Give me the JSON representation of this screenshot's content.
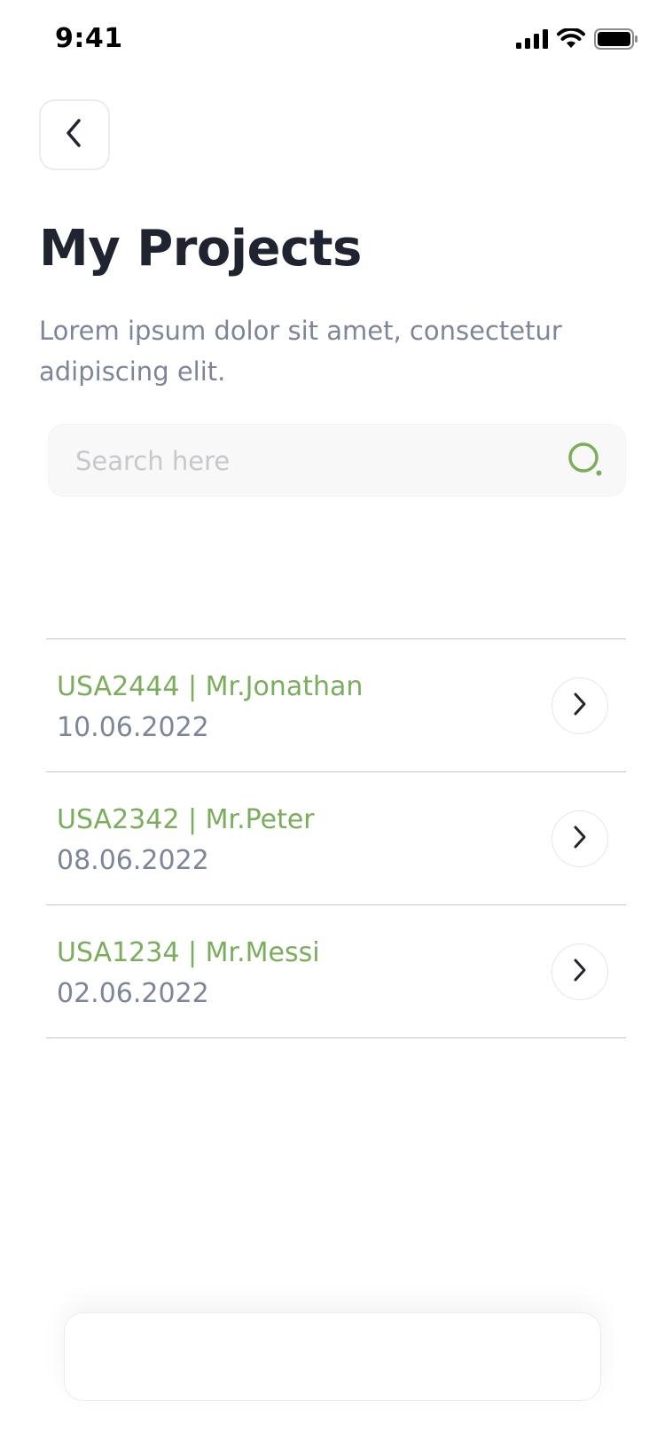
{
  "status_bar": {
    "time": "9:41",
    "icons": [
      "signal-icon",
      "wifi-icon",
      "battery-icon"
    ]
  },
  "header": {
    "back_icon": "chevron-left-icon",
    "title": "My Projects",
    "subtitle": "Lorem ipsum dolor sit amet, consectetur adipiscing elit."
  },
  "search": {
    "placeholder": "Search here",
    "value": "",
    "icon": "search-icon"
  },
  "projects": [
    {
      "title": "USA2444 | Mr.Jonathan",
      "date": "10.06.2022",
      "icon": "chevron-right-icon"
    },
    {
      "title": "USA2342 | Mr.Peter",
      "date": "08.06.2022",
      "icon": "chevron-right-icon"
    },
    {
      "title": "USA1234 | Mr.Messi",
      "date": "02.06.2022",
      "icon": "chevron-right-icon"
    }
  ],
  "colors": {
    "accent": "#7aad5c",
    "title": "#1f2430",
    "muted": "#7c8698",
    "divider": "#c6c6c6"
  }
}
